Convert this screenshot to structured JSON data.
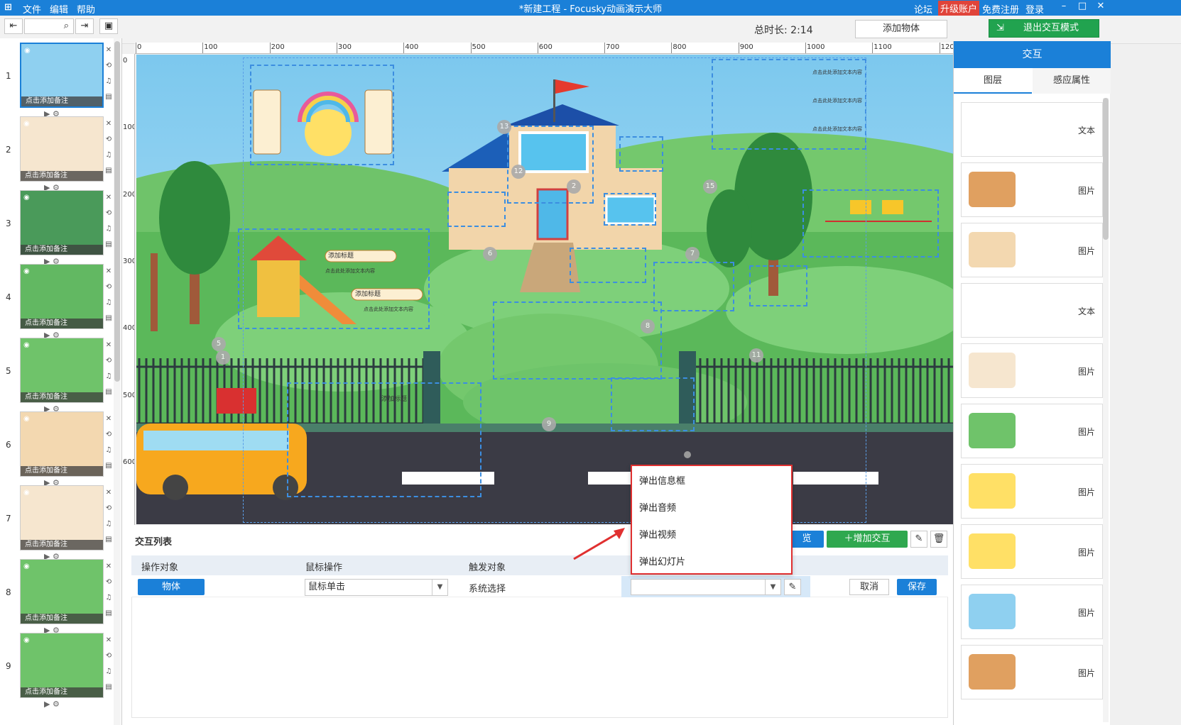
{
  "titlebar": {
    "app_icon": "app-logo-icon",
    "menu": [
      "文件",
      "编辑",
      "帮助"
    ],
    "title": "*新建工程 - Focusky动画演示大师",
    "right_links": [
      "论坛",
      "升级账户",
      "免费注册",
      "登录"
    ],
    "window_buttons": [
      "–",
      "□",
      "✕"
    ]
  },
  "toolbar": {
    "total_duration": "总时长: 2:14",
    "add_object": "添加物体",
    "exit_interaction": "退出交互模式"
  },
  "slides": [
    {
      "num": "1",
      "note": "点击添加备注"
    },
    {
      "num": "2",
      "note": "点击添加备注"
    },
    {
      "num": "3",
      "note": "点击添加备注"
    },
    {
      "num": "4",
      "note": "点击添加备注"
    },
    {
      "num": "5",
      "note": "点击添加备注"
    },
    {
      "num": "6",
      "note": "点击添加备注"
    },
    {
      "num": "7",
      "note": "点击添加备注"
    },
    {
      "num": "8",
      "note": "点击添加备注"
    },
    {
      "num": "9",
      "note": "点击添加备注"
    }
  ],
  "ruler_h": [
    "0",
    "100",
    "200",
    "300",
    "400",
    "500",
    "600",
    "700",
    "800",
    "900",
    "1000",
    "1100",
    "120"
  ],
  "ruler_v": [
    "0",
    "100",
    "200",
    "300",
    "400",
    "500",
    "600"
  ],
  "canvas": {
    "badges": [
      "13",
      "12",
      "2",
      "15",
      "6",
      "7",
      "8",
      "5",
      "1",
      "11",
      "9"
    ],
    "placeholder_title": "添加标题",
    "placeholder_text": "点击此处添加文本内容"
  },
  "rightpanel": {
    "header": "交互",
    "tabs": [
      "图层",
      "感应属性"
    ],
    "layers": [
      "文本",
      "图片",
      "图片",
      "文本",
      "图片",
      "图片",
      "图片",
      "图片",
      "图片",
      "图片"
    ]
  },
  "interaction_list": {
    "title": "交互列表",
    "preview_partial": "览",
    "add_interaction": "增加交互",
    "columns": [
      "操作对象",
      "鼠标操作",
      "触发对象"
    ],
    "row": {
      "object": "物体",
      "mouse_action": "鼠标单击",
      "trigger": "系统选择",
      "action_value": "",
      "cancel": "取消",
      "save": "保存"
    }
  },
  "dropdown": {
    "options": [
      "弹出信息框",
      "弹出音频",
      "弹出视频",
      "弹出幻灯片"
    ]
  },
  "colors": {
    "accent": "#1b80d8",
    "exit_green": "#21a34f",
    "highlight_red": "#e03030"
  }
}
